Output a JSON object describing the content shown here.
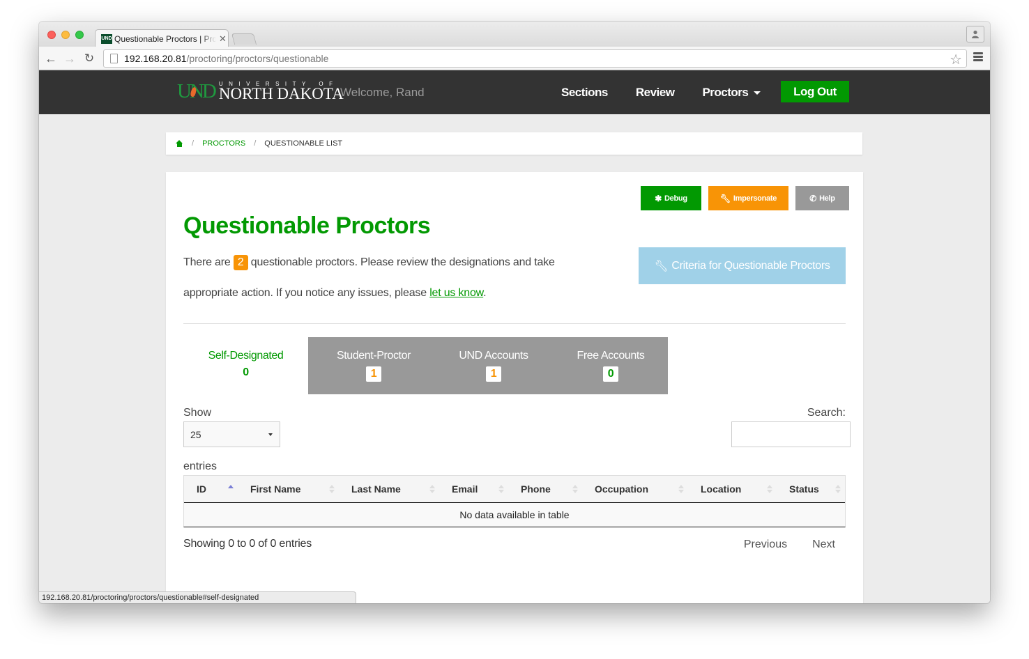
{
  "browser": {
    "tab_title": "Questionable Proctors | Proctoring",
    "tab_favicon_text": "UND",
    "url_host": "192.168.20.81",
    "url_path": "/proctoring/proctors/questionable",
    "status_url": "192.168.20.81/proctoring/proctors/questionable#self-designated"
  },
  "navbar": {
    "logo_und": "UND",
    "logo_university_of": "UNIVERSITY OF",
    "logo_north_dakota": "NORTH DAKOTA",
    "welcome": "Welcome, Rand",
    "links": [
      {
        "label": "Sections"
      },
      {
        "label": "Review"
      },
      {
        "label": "Proctors"
      }
    ],
    "logout_label": "Log Out"
  },
  "breadcrumb": {
    "items": [
      "Proctors",
      "Questionable List"
    ],
    "separator": "/"
  },
  "actions": {
    "debug_label": "Debug",
    "impersonate_label": "Impersonate",
    "help_label": "Help"
  },
  "page": {
    "title": "Questionable Proctors",
    "intro_before": "There are",
    "questionable_count": "2",
    "intro_after": "questionable proctors. Please review the designations and take appropriate action. If you notice any issues, please",
    "link_text": "let us know",
    "intro_end": ".",
    "criteria_button": "Criteria for Questionable Proctors"
  },
  "designation_tabs": [
    {
      "label": "Self-Designated",
      "count": "0",
      "active": true
    },
    {
      "label": "Student-Proctor",
      "count": "1",
      "active": false
    },
    {
      "label": "UND Accounts",
      "count": "1",
      "active": false
    },
    {
      "label": "Free Accounts",
      "count": "0",
      "active": false
    }
  ],
  "datatable": {
    "show_label": "Show",
    "page_length": "25",
    "entries_label": "entries",
    "search_label": "Search:",
    "search_value": "",
    "columns": [
      "ID",
      "First Name",
      "Last Name",
      "Email",
      "Phone",
      "Occupation",
      "Location",
      "Status"
    ],
    "empty_message": "No data available in table",
    "info": "Showing 0 to 0 of 0 entries",
    "previous_label": "Previous",
    "next_label": "Next"
  },
  "colors": {
    "brand_green": "#029902",
    "warning_orange": "#f89406",
    "info_blue": "#a0d1e8",
    "navbar_dark": "#333333",
    "neutral_gray": "#999999"
  }
}
